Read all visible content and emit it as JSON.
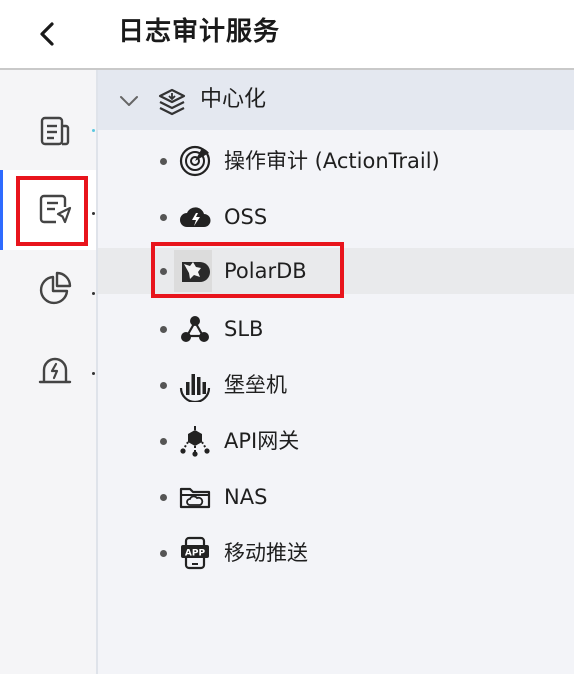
{
  "header": {
    "title": "日志审计服务"
  },
  "rail": {
    "items": [
      {
        "icon": "document-list-icon"
      },
      {
        "icon": "audit-send-icon",
        "active": true
      },
      {
        "icon": "pie-chart-icon"
      },
      {
        "icon": "alarm-icon"
      }
    ]
  },
  "tree": {
    "group": {
      "label": "中心化",
      "icon": "layers-icon",
      "expanded": true
    },
    "nodes": [
      {
        "label": "操作审计 (ActionTrail)",
        "icon": "radar-icon"
      },
      {
        "label": "OSS",
        "icon": "cloud-bolt-icon"
      },
      {
        "label": "PolarDB",
        "icon": "polardb-bear-icon",
        "selected": true
      },
      {
        "label": "SLB",
        "icon": "network-nodes-icon"
      },
      {
        "label": "堡垒机",
        "icon": "bastion-bars-icon"
      },
      {
        "label": "API网关",
        "icon": "api-gateway-icon"
      },
      {
        "label": "NAS",
        "icon": "nas-folder-icon"
      },
      {
        "label": "移动推送",
        "icon": "app-push-icon"
      }
    ]
  },
  "colors": {
    "highlight": "#e8141c",
    "accent": "#2f6bff",
    "panel_bg": "#f3f4f8",
    "group_bg": "#e4e8f0"
  }
}
